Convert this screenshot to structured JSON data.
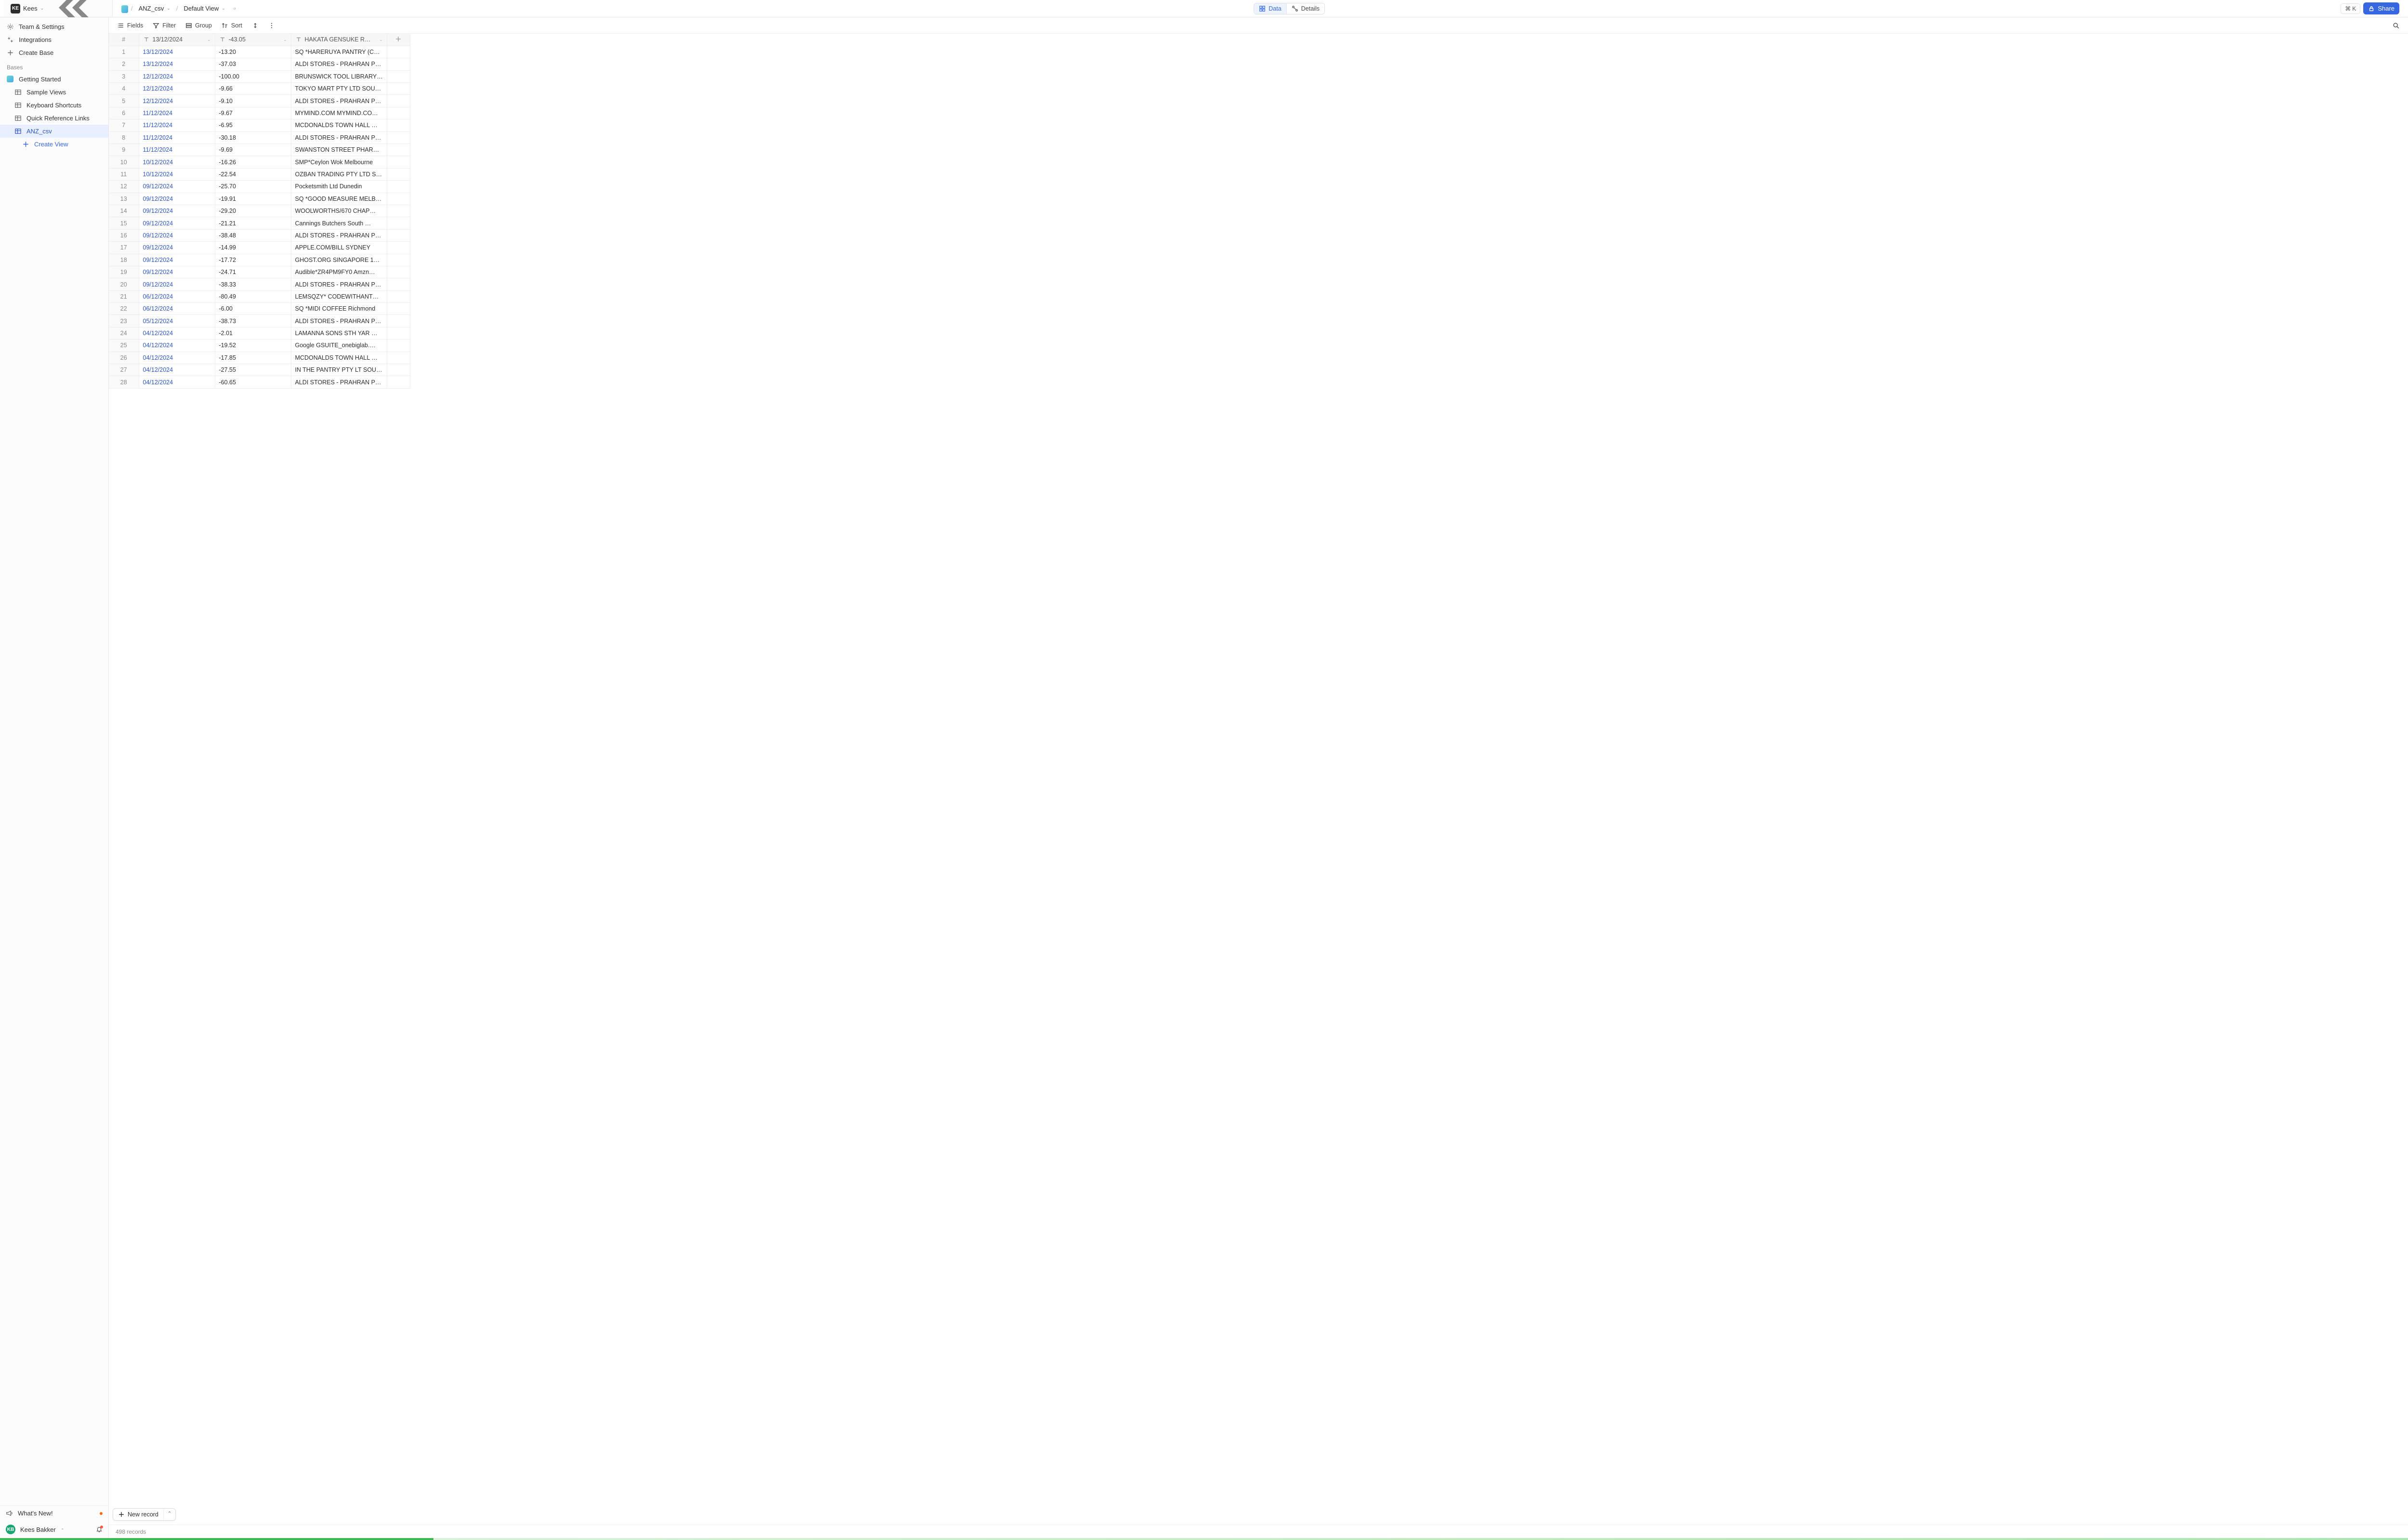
{
  "workspace": {
    "badge": "KE",
    "name": "Kees"
  },
  "breadcrumb": {
    "table": "ANZ_csv",
    "view": "Default View"
  },
  "segmented": {
    "data": "Data",
    "details": "Details"
  },
  "cmd": {
    "glyph": "⌘",
    "key": "K"
  },
  "share": "Share",
  "sidebar": {
    "team": "Team & Settings",
    "integrations": "Integrations",
    "createBase": "Create Base",
    "section": "Bases",
    "base": "Getting Started",
    "tables": [
      "Sample Views",
      "Keyboard Shortcuts",
      "Quick Reference Links",
      "ANZ_csv"
    ],
    "activeTable": "ANZ_csv",
    "createView": "Create View",
    "whatsNew": "What's New!",
    "user": "Kees Bakker",
    "userBadge": "KB"
  },
  "toolbar": {
    "fields": "Fields",
    "filter": "Filter",
    "group": "Group",
    "sort": "Sort"
  },
  "columns": {
    "rownum": "#",
    "date": "13/12/2024",
    "amount": "-43.05",
    "desc": "HAKATA GENSUKE R…"
  },
  "rows": [
    {
      "n": 1,
      "date": "13/12/2024",
      "amt": "-13.20",
      "desc": "SQ *HARERUYA PANTRY (C…"
    },
    {
      "n": 2,
      "date": "13/12/2024",
      "amt": "-37.03",
      "desc": "ALDI STORES - PRAHRAN P…"
    },
    {
      "n": 3,
      "date": "12/12/2024",
      "amt": "-100.00",
      "desc": "BRUNSWICK TOOL LIBRARY…"
    },
    {
      "n": 4,
      "date": "12/12/2024",
      "amt": "-9.66",
      "desc": "TOKYO MART PTY LTD SOU…"
    },
    {
      "n": 5,
      "date": "12/12/2024",
      "amt": "-9.10",
      "desc": "ALDI STORES - PRAHRAN P…"
    },
    {
      "n": 6,
      "date": "11/12/2024",
      "amt": "-9.67",
      "desc": "MYMIND.COM MYMIND.CO…"
    },
    {
      "n": 7,
      "date": "11/12/2024",
      "amt": "-6.95",
      "desc": "MCDONALDS TOWN HALL …"
    },
    {
      "n": 8,
      "date": "11/12/2024",
      "amt": "-30.18",
      "desc": "ALDI STORES - PRAHRAN P…"
    },
    {
      "n": 9,
      "date": "11/12/2024",
      "amt": "-9.69",
      "desc": "SWANSTON STREET PHAR…"
    },
    {
      "n": 10,
      "date": "10/12/2024",
      "amt": "-16.26",
      "desc": "SMP*Ceylon Wok Melbourne"
    },
    {
      "n": 11,
      "date": "10/12/2024",
      "amt": "-22.54",
      "desc": "OZBAN TRADING PTY LTD S…"
    },
    {
      "n": 12,
      "date": "09/12/2024",
      "amt": "-25.70",
      "desc": "Pocketsmith Ltd Dunedin"
    },
    {
      "n": 13,
      "date": "09/12/2024",
      "amt": "-19.91",
      "desc": "SQ *GOOD MEASURE MELB…"
    },
    {
      "n": 14,
      "date": "09/12/2024",
      "amt": "-29.20",
      "desc": "WOOLWORTHS/670 CHAP…"
    },
    {
      "n": 15,
      "date": "09/12/2024",
      "amt": "-21.21",
      "desc": "Cannings Butchers South …"
    },
    {
      "n": 16,
      "date": "09/12/2024",
      "amt": "-38.48",
      "desc": "ALDI STORES - PRAHRAN P…"
    },
    {
      "n": 17,
      "date": "09/12/2024",
      "amt": "-14.99",
      "desc": "APPLE.COM/BILL SYDNEY"
    },
    {
      "n": 18,
      "date": "09/12/2024",
      "amt": "-17.72",
      "desc": "GHOST.ORG SINGAPORE 1…"
    },
    {
      "n": 19,
      "date": "09/12/2024",
      "amt": "-24.71",
      "desc": "Audible*ZR4PM9FY0 Amzn…"
    },
    {
      "n": 20,
      "date": "09/12/2024",
      "amt": "-38.33",
      "desc": "ALDI STORES - PRAHRAN P…"
    },
    {
      "n": 21,
      "date": "06/12/2024",
      "amt": "-80.49",
      "desc": "LEMSQZY* CODEWITHANT…"
    },
    {
      "n": 22,
      "date": "06/12/2024",
      "amt": "-6.00",
      "desc": "SQ *MIDI COFFEE Richmond"
    },
    {
      "n": 23,
      "date": "05/12/2024",
      "amt": "-38.73",
      "desc": "ALDI STORES - PRAHRAN P…"
    },
    {
      "n": 24,
      "date": "04/12/2024",
      "amt": "-2.01",
      "desc": "LAMANNA SONS STH YAR …"
    },
    {
      "n": 25,
      "date": "04/12/2024",
      "amt": "-19.52",
      "desc": "Google GSUITE_onebiglab.…"
    },
    {
      "n": 26,
      "date": "04/12/2024",
      "amt": "-17.85",
      "desc": "MCDONALDS TOWN HALL …"
    },
    {
      "n": 27,
      "date": "04/12/2024",
      "amt": "-27.55",
      "desc": "IN THE PANTRY PTY LT SOU…"
    },
    {
      "n": 28,
      "date": "04/12/2024",
      "amt": "-60.65",
      "desc": "ALDI STORES - PRAHRAN P…"
    }
  ],
  "newRecord": "New record",
  "footer": "498 records"
}
